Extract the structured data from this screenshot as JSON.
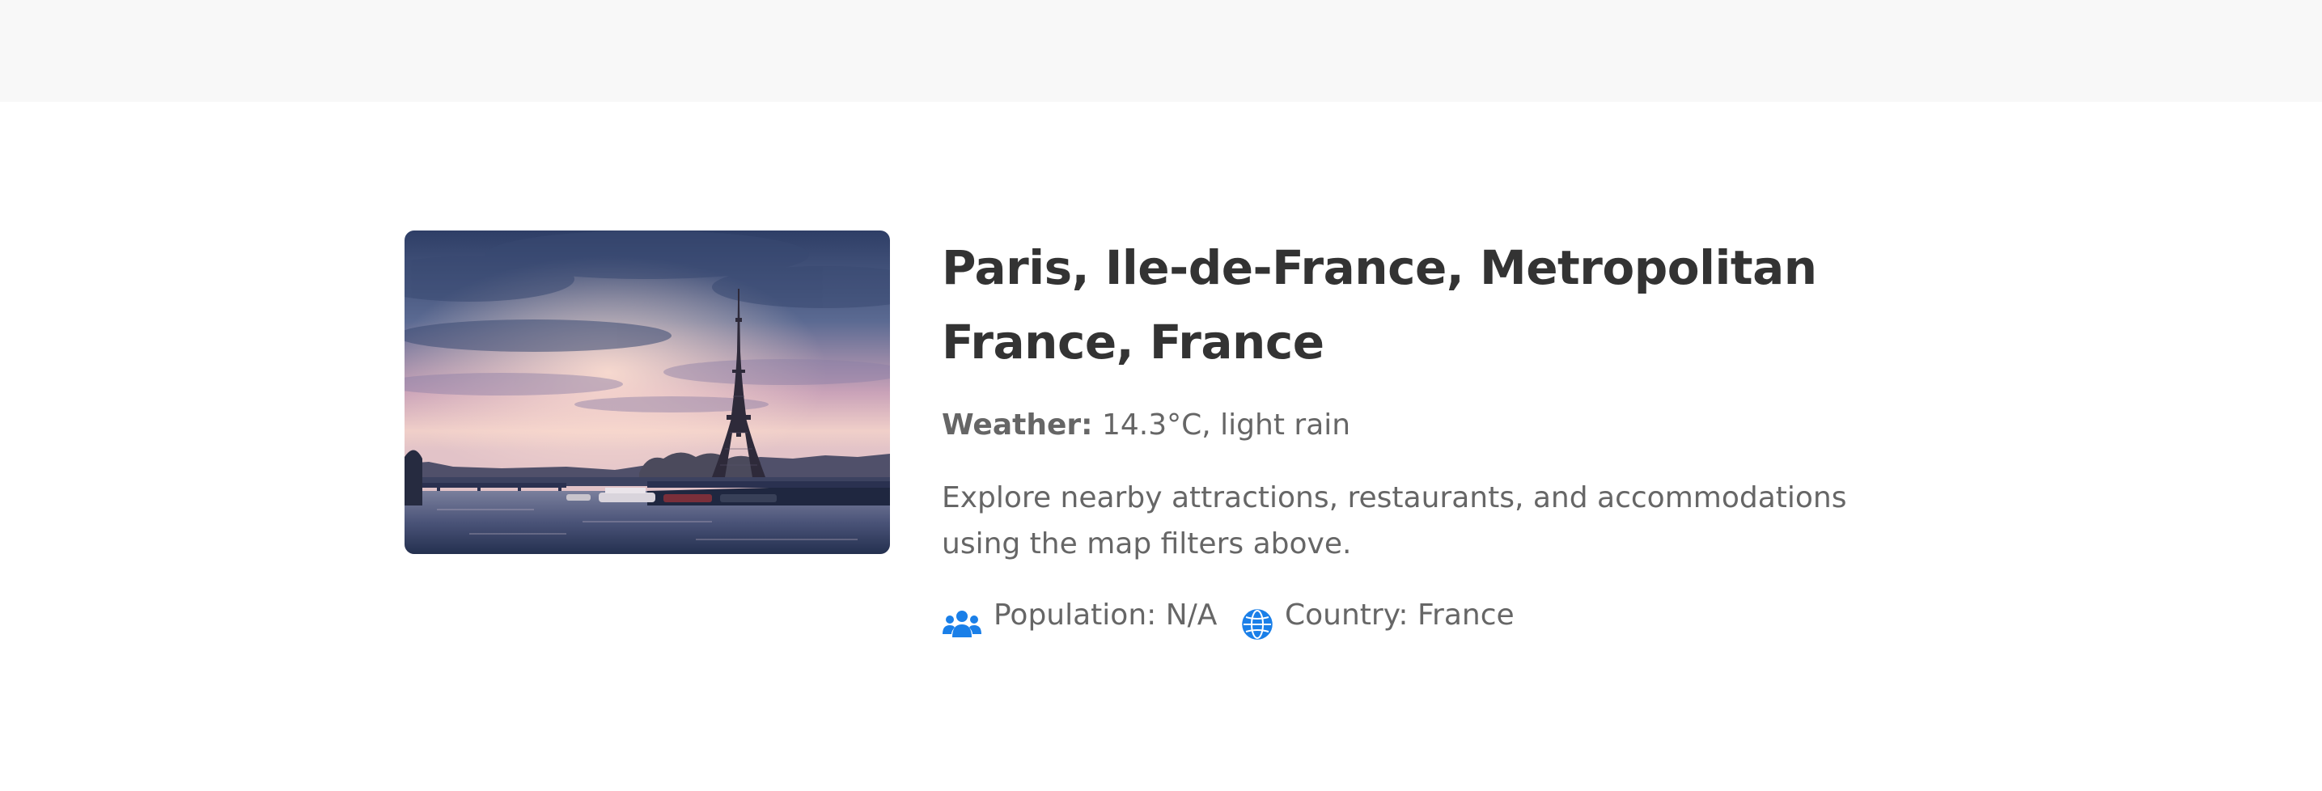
{
  "location": {
    "title": "Paris, Ile-de-France, Metropolitan France, France",
    "image_subject": "Eiffel Tower over the Seine at dusk",
    "weather_label": "Weather:",
    "weather_value": "14.3°C, light rain",
    "description": "Explore nearby attractions, restaurants, and accommodations using the map filters above.",
    "population_text": "Population: N/A",
    "country_text": "Country: France"
  },
  "icons": {
    "population": "users-icon",
    "country": "globe-icon"
  },
  "colors": {
    "accent": "#1a7fe8",
    "title": "#333333",
    "body_text": "#666666",
    "topbar": "#f8f8f8"
  }
}
